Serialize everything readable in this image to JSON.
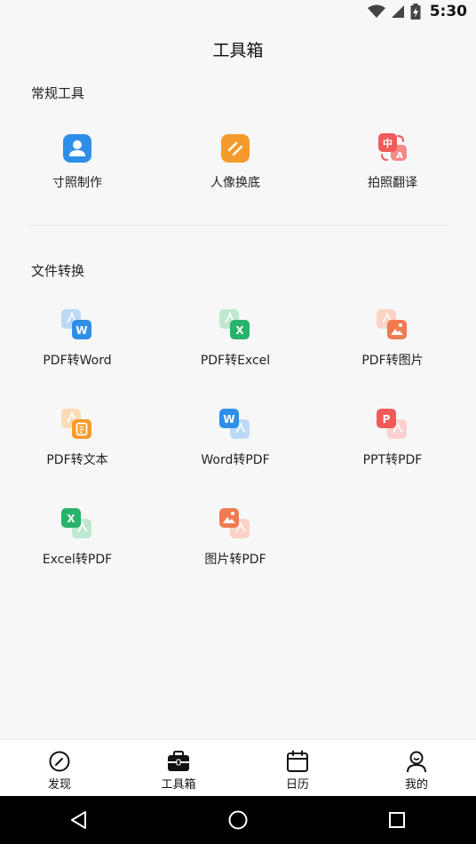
{
  "status": {
    "time": "5:30"
  },
  "header": {
    "title": "工具箱"
  },
  "sections": {
    "common": {
      "title": "常规工具",
      "items": [
        {
          "label": "寸照制作"
        },
        {
          "label": "人像换底"
        },
        {
          "label": "拍照翻译"
        }
      ]
    },
    "convert": {
      "title": "文件转换",
      "items": [
        {
          "label": "PDF转Word"
        },
        {
          "label": "PDF转Excel"
        },
        {
          "label": "PDF转图片"
        },
        {
          "label": "PDF转文本"
        },
        {
          "label": "Word转PDF"
        },
        {
          "label": "PPT转PDF"
        },
        {
          "label": "Excel转PDF"
        },
        {
          "label": "图片转PDF"
        }
      ]
    }
  },
  "translate_icon": {
    "zh": "中",
    "en": "A"
  },
  "badges": {
    "word": "W",
    "excel": "X",
    "ppt": "P"
  },
  "bottom_nav": {
    "items": [
      {
        "label": "发现"
      },
      {
        "label": "工具箱"
      },
      {
        "label": "日历"
      },
      {
        "label": "我的"
      }
    ]
  },
  "colors": {
    "blue": "#2f8fe8",
    "orange": "#f59a2c",
    "red": "#f06060",
    "green": "#28b36a",
    "coral": "#f07a50"
  }
}
